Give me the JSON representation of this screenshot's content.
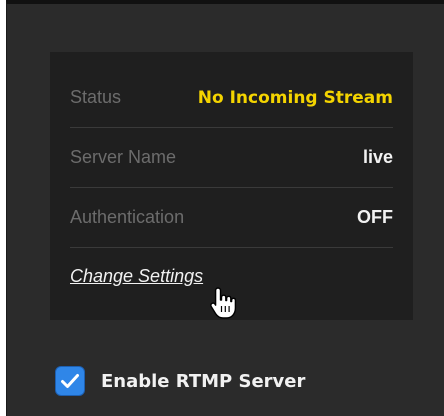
{
  "status": {
    "label": "Status",
    "value": "No Incoming Stream",
    "value_color": "#f4d400"
  },
  "server_name": {
    "label": "Server Name",
    "value": "live"
  },
  "authentication": {
    "label": "Authentication",
    "value": "OFF"
  },
  "change_settings_link": "Change Settings",
  "enable_rtmp": {
    "label": "Enable RTMP Server",
    "checked": true,
    "checkbox_color": "#2f86e8"
  },
  "cursor_icon": "hand-pointer-icon",
  "checkmark_icon": "checkmark-icon"
}
